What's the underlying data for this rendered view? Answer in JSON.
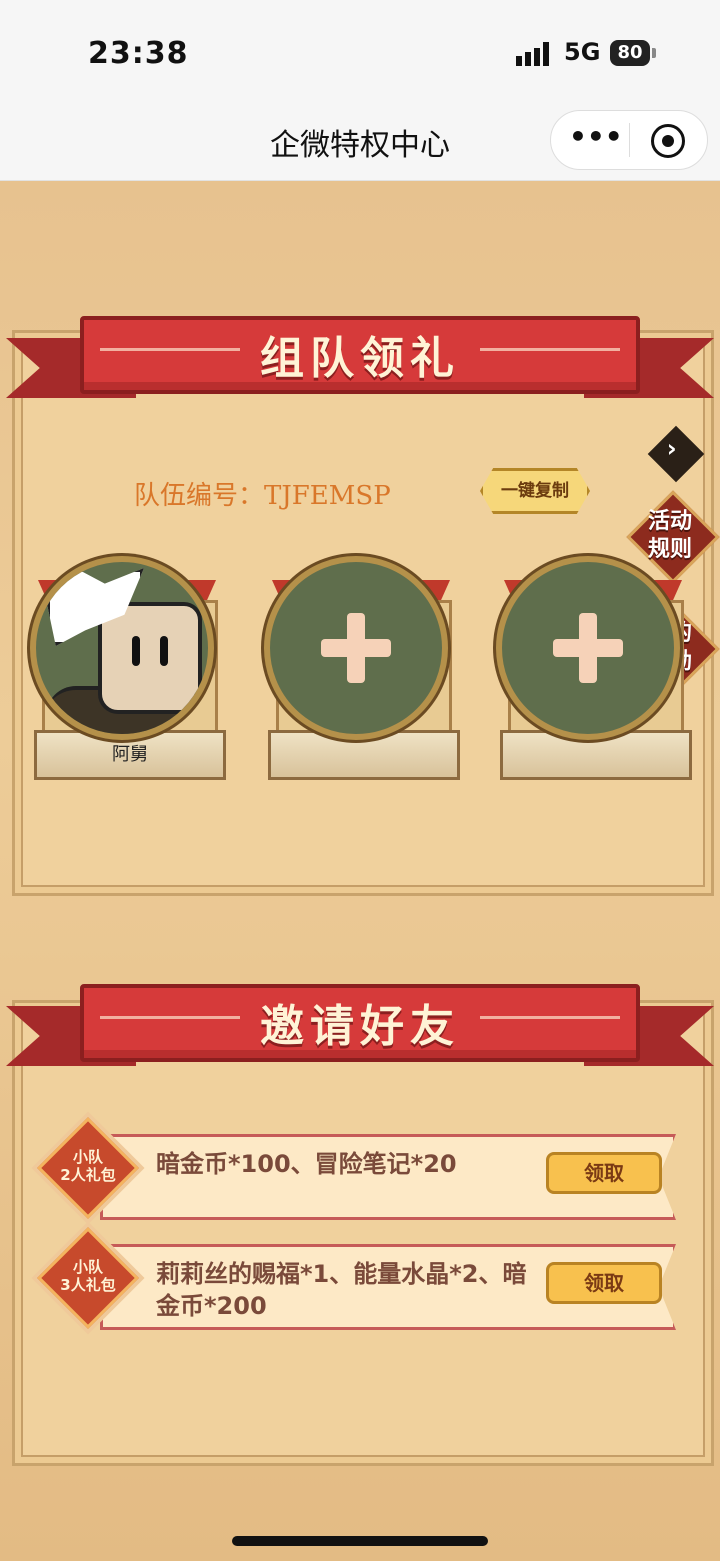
{
  "status": {
    "time": "23:38",
    "network": "5G",
    "battery": "80"
  },
  "nav": {
    "title": "企微特权中心",
    "more_icon": "more-dots-icon",
    "close_icon": "target-icon"
  },
  "team_section": {
    "title": "组队领礼",
    "team_id_label": "队伍编号：TJFEMSP",
    "copy_button": "一键复制",
    "members": [
      {
        "name": "阿舅"
      },
      {
        "name": ""
      },
      {
        "name": ""
      }
    ]
  },
  "side": {
    "rules": "活动\n规则",
    "rewards": "我的\n奖励"
  },
  "invite_section": {
    "title": "邀请好友",
    "gifts": [
      {
        "badge": "小队\n2人礼包",
        "text": "暗金币*100、冒险笔记*20",
        "button": "领取"
      },
      {
        "badge": "小队\n3人礼包",
        "text": "莉莉丝的赐福*1、能量水晶*2、暗金币*200",
        "button": "领取"
      }
    ]
  },
  "colors": {
    "ribbon": "#d63a3a",
    "parchment": "#f0d19d",
    "accent": "#d9772a",
    "button": "#f8c14e"
  }
}
